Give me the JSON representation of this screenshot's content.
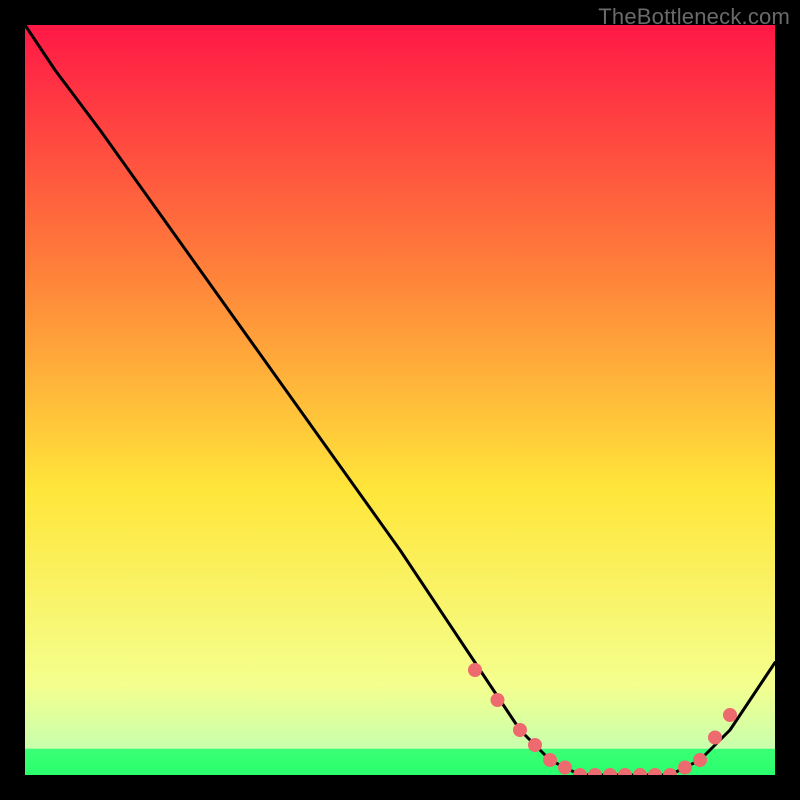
{
  "watermark": "TheBottleneck.com",
  "colors": {
    "gradient_top": "#ff1846",
    "gradient_mid1": "#ff7e3a",
    "gradient_mid2": "#ffe63a",
    "gradient_mid3": "#f4ff8e",
    "gradient_bottom": "#2aff6e",
    "curve_stroke": "#000000",
    "dot_fill": "#ed6a6f",
    "dot_stroke": "#ed6a6f"
  },
  "chart_data": {
    "type": "line",
    "title": "",
    "xlabel": "",
    "ylabel": "",
    "xlim": [
      0,
      100
    ],
    "ylim": [
      0,
      100
    ],
    "grid": false,
    "legend": false,
    "series": [
      {
        "name": "bottleneck-curve",
        "x": [
          0,
          4,
          10,
          20,
          30,
          40,
          50,
          58,
          62,
          66,
          70,
          74,
          78,
          82,
          86,
          90,
          94,
          98,
          100
        ],
        "y": [
          100,
          94,
          86,
          72,
          58,
          44,
          30,
          18,
          12,
          6,
          2,
          0,
          0,
          0,
          0,
          2,
          6,
          12,
          15
        ]
      }
    ],
    "highlight_points": {
      "name": "dotted-trough",
      "x": [
        60,
        63,
        66,
        68,
        70,
        72,
        74,
        76,
        78,
        80,
        82,
        84,
        86,
        88,
        90,
        92,
        94
      ],
      "y": [
        14,
        10,
        6,
        4,
        2,
        1,
        0,
        0,
        0,
        0,
        0,
        0,
        0,
        1,
        2,
        5,
        8
      ]
    }
  }
}
